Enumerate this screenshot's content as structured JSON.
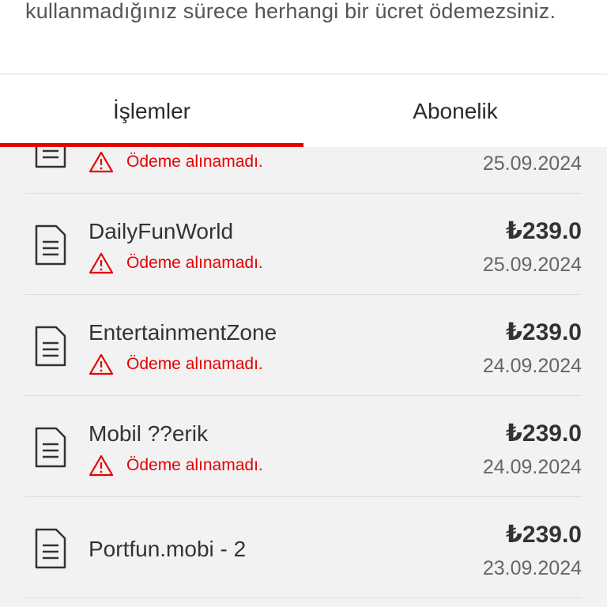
{
  "colors": {
    "accent": "#e60000",
    "text_primary": "#333333",
    "text_secondary": "#666666",
    "background": "#f2f2f2"
  },
  "top_note": {
    "text": "kullanmadığınız sürece herhangi bir ücret ödemezsiniz."
  },
  "tabs": [
    {
      "label": "İşlemler",
      "selected": true
    },
    {
      "label": "Abonelik",
      "selected": false
    }
  ],
  "transactions": [
    {
      "title": "",
      "status": "Ödeme alınamadı.",
      "amount": "",
      "date": "25.09.2024",
      "icon": "document-icon",
      "status_icon": "warning-icon"
    },
    {
      "title": "DailyFunWorld",
      "status": "Ödeme alınamadı.",
      "amount": "₺239.0",
      "date": "25.09.2024",
      "icon": "document-icon",
      "status_icon": "warning-icon"
    },
    {
      "title": "EntertainmentZone",
      "status": "Ödeme alınamadı.",
      "amount": "₺239.0",
      "date": "24.09.2024",
      "icon": "document-icon",
      "status_icon": "warning-icon"
    },
    {
      "title": "Mobil ??erik",
      "status": "Ödeme alınamadı.",
      "amount": "₺239.0",
      "date": "24.09.2024",
      "icon": "document-icon",
      "status_icon": "warning-icon"
    },
    {
      "title": "Portfun.mobi - 2",
      "status": "",
      "amount": "₺239.0",
      "date": "23.09.2024",
      "icon": "document-icon",
      "status_icon": ""
    }
  ]
}
